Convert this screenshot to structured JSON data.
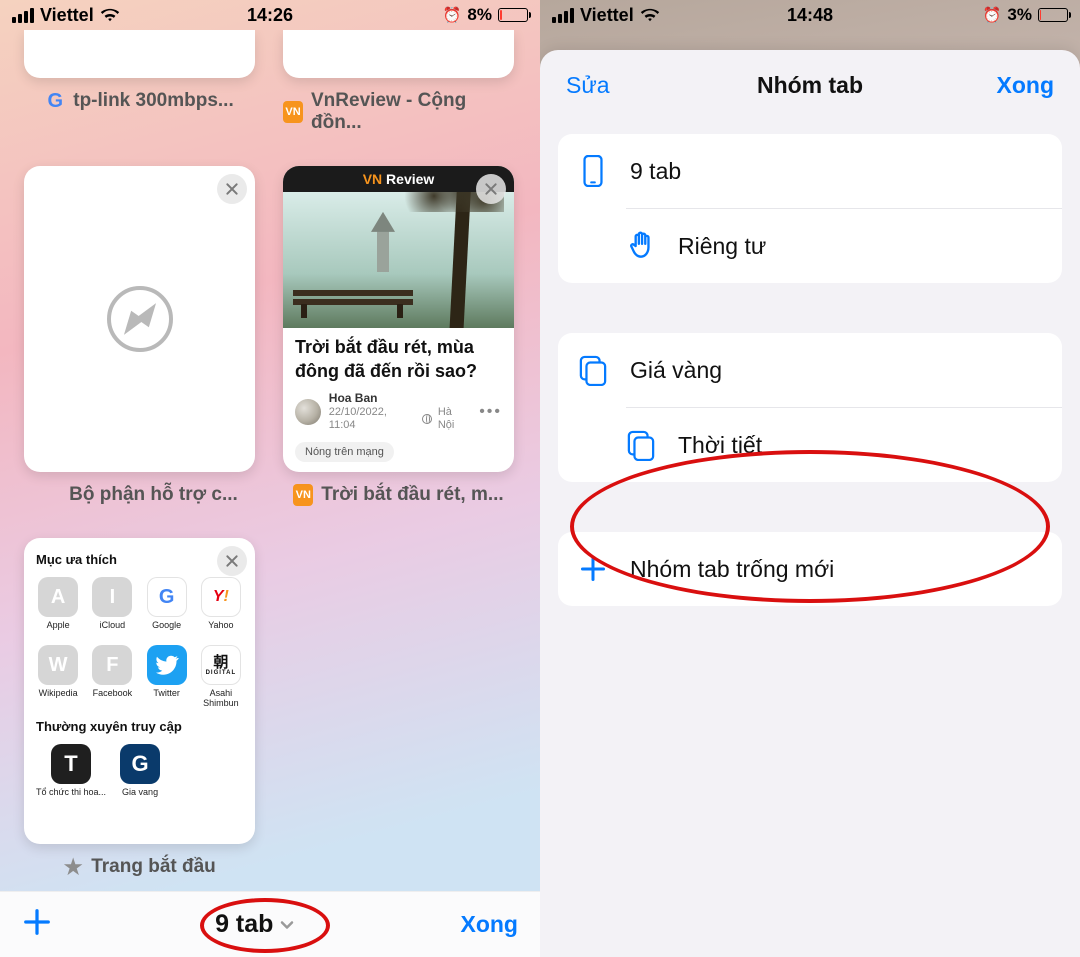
{
  "left": {
    "status": {
      "carrier": "Viettel",
      "time": "14:26",
      "battery_text": "8%",
      "battery_pct": 8
    },
    "row1": {
      "tab_a": {
        "title": "tp-link 300mbps...",
        "favicon": "google"
      },
      "tab_b": {
        "title": "VnReview - Cộng đồn...",
        "favicon": "vnreview"
      }
    },
    "row2": {
      "tab_a": {
        "title": "Bộ phận hỗ trợ c...",
        "favicon": "apple"
      },
      "tab_b": {
        "title": "Trời bắt đầu rét, m...",
        "favicon": "vnreview",
        "site_header": "Review",
        "article_title": "Trời bắt đầu rét, mùa đông đã đến rồi sao?",
        "author": "Hoa Ban",
        "datetime": "22/10/2022, 11:04",
        "location": "Hà Nội",
        "tag": "Nóng trên mạng"
      }
    },
    "row3": {
      "tab_a": {
        "title": "Trang bắt đầu",
        "favicon": "star",
        "section_fav": "Mục ưa thích",
        "fav_items": [
          {
            "letter": "A",
            "label": "Apple",
            "kind": "gray"
          },
          {
            "letter": "I",
            "label": "iCloud",
            "kind": "gray"
          },
          {
            "letter": "G",
            "label": "Google",
            "kind": "google"
          },
          {
            "letter": "Y!",
            "label": "Yahoo",
            "kind": "yahoo"
          },
          {
            "letter": "W",
            "label": "Wikipedia",
            "kind": "gray"
          },
          {
            "letter": "F",
            "label": "Facebook",
            "kind": "gray"
          },
          {
            "letter": "",
            "label": "Twitter",
            "kind": "twitter"
          },
          {
            "letter": "朝",
            "label": "Asahi Shimbun",
            "kind": "asahi"
          }
        ],
        "section_freq": "Thường xuyên truy cập",
        "freq_items": [
          {
            "letter": "T",
            "label": "Tổ chức thi hoa...",
            "color": "#1f1f1f"
          },
          {
            "letter": "G",
            "label": "Gia vang",
            "color": "#0a3a6b"
          }
        ]
      }
    },
    "bottombar": {
      "count_label": "9 tab",
      "done": "Xong"
    }
  },
  "right": {
    "status": {
      "carrier": "Viettel",
      "time": "14:48",
      "battery_text": "3%",
      "battery_pct": 3
    },
    "sheet": {
      "edit": "Sửa",
      "title": "Nhóm tab",
      "done": "Xong",
      "group1": [
        {
          "icon": "phone",
          "label": "9 tab"
        },
        {
          "icon": "hand",
          "label": "Riêng tư"
        }
      ],
      "group2": [
        {
          "icon": "stack",
          "label": "Giá vàng"
        },
        {
          "icon": "stack",
          "label": "Thời tiết"
        }
      ],
      "group3": [
        {
          "icon": "plus",
          "label": "Nhóm tab trống mới"
        }
      ]
    }
  }
}
